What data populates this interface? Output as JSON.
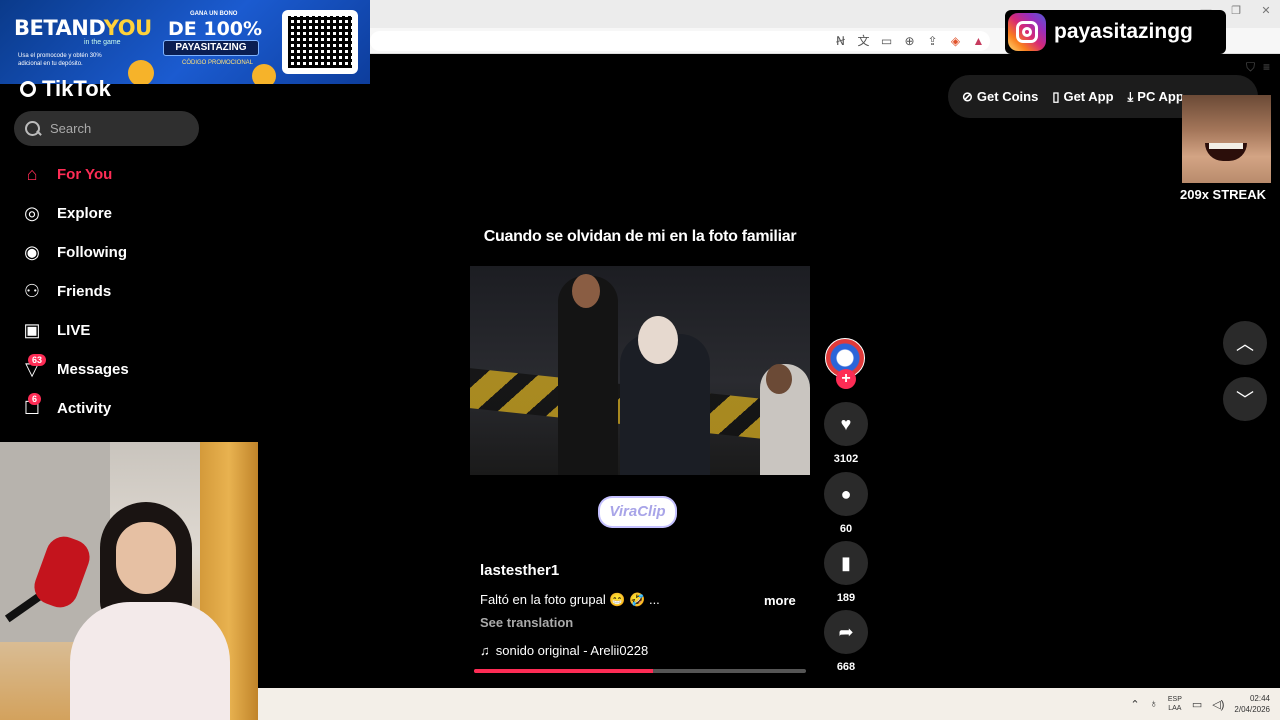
{
  "promo": {
    "brand_part1": "BETAND",
    "brand_part2": "YOU",
    "brand_sub": "in the game",
    "note": "Usa el promocode y obtén 30% adicional en tu depósito.",
    "bonus_line1": "GANA UN BONO",
    "bonus_line2": "DE 100%",
    "code": "PAYASITAZING",
    "code_label": "CÓDIGO PROMOCIONAL"
  },
  "instagram": {
    "handle": "payasitazingg"
  },
  "tiktok": {
    "logo": "TikTok",
    "search_placeholder": "Search",
    "nav": [
      {
        "label": "For You",
        "icon": "home-icon",
        "glyph": "⌂",
        "active": true
      },
      {
        "label": "Explore",
        "icon": "compass-icon",
        "glyph": "◎"
      },
      {
        "label": "Following",
        "icon": "following-avatar-icon",
        "glyph": "◉"
      },
      {
        "label": "Friends",
        "icon": "friends-icon",
        "glyph": "⚇"
      },
      {
        "label": "LIVE",
        "icon": "live-tv-icon",
        "glyph": "▣"
      },
      {
        "label": "Messages",
        "icon": "messages-icon",
        "glyph": "▽",
        "badge": "63"
      },
      {
        "label": "Activity",
        "icon": "activity-icon",
        "glyph": "☐",
        "badge": "6"
      }
    ],
    "top_buttons": {
      "coins": "Get Coins",
      "app": "Get App",
      "pc_app": "PC App"
    }
  },
  "overlay": {
    "streak": "209x STREAK"
  },
  "video": {
    "caption": "Cuando se olvidan de mi en la foto familiar",
    "watermark": "ViraClip",
    "author": "lastesther1",
    "description": "Faltó en la foto grupal 😁 🤣 ...",
    "more": "more",
    "see_translation": "See translation",
    "sound": "sonido original - Arelii0228",
    "progress_fraction": 0.54
  },
  "actions": {
    "likes": "3102",
    "comments": "60",
    "saves": "189",
    "shares": "668"
  },
  "taskbar": {
    "lang_top": "ESP",
    "lang_bottom": "LAA",
    "time": "02:44",
    "date": "2/04/2026"
  },
  "colors": {
    "accent": "#fe2c55",
    "panel": "#2a2a2a",
    "background": "#000000"
  }
}
